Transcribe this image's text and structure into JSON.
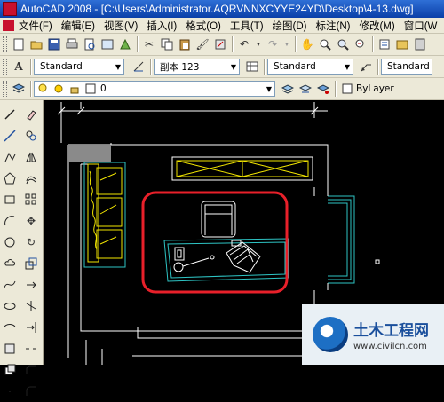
{
  "window": {
    "title": "AutoCAD 2008 - [C:\\Users\\Administrator.AQRVNNXCYYE24YD\\Desktop\\4-13.dwg]"
  },
  "menu": [
    {
      "label": "文件(F)"
    },
    {
      "label": "编辑(E)"
    },
    {
      "label": "视图(V)"
    },
    {
      "label": "插入(I)"
    },
    {
      "label": "格式(O)"
    },
    {
      "label": "工具(T)"
    },
    {
      "label": "绘图(D)"
    },
    {
      "label": "标注(N)"
    },
    {
      "label": "修改(M)"
    },
    {
      "label": "窗口(W"
    }
  ],
  "styles_toolbar": {
    "text_style": "Standard",
    "dim_style": "副本 123",
    "table_style": "Standard",
    "mleader_style": "Standard"
  },
  "layers_toolbar": {
    "current_layer": "0",
    "color": "ByLayer"
  },
  "watermark": {
    "title": "土木工程网",
    "url": "www.civilcn.com"
  },
  "colors": {
    "highlight_box": "#e8202a",
    "drawing_lines": "#ffffff",
    "sofa": "#f2e600",
    "furniture": "#2ec4c4"
  }
}
